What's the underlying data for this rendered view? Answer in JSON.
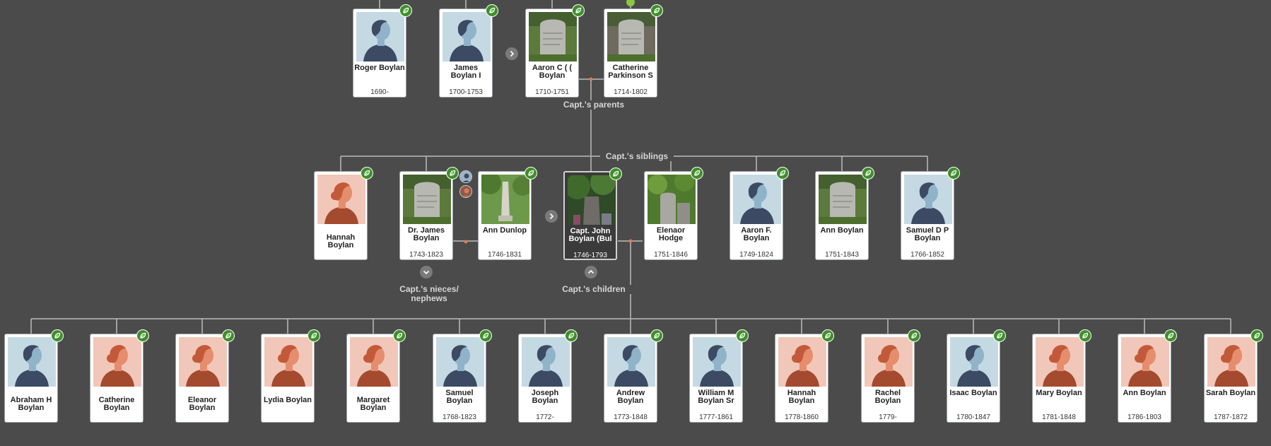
{
  "labels": {
    "parents": "Capt.'s parents",
    "siblings": "Capt.'s siblings",
    "nieces": "Capt.'s nieces/ nephews",
    "children": "Capt.'s children"
  },
  "icons": {
    "hint": "leaf-hint-icon",
    "expand_right": "chevron-right-icon",
    "expand_down": "chevron-down-icon",
    "collapse_up": "chevron-up-icon"
  },
  "colors": {
    "background": "#4b4b4b",
    "line": "#bdbdbd",
    "hint": "#3f8f2a",
    "male_bg": "#c5d9e3",
    "female_bg": "#f1c7b9"
  },
  "people": {
    "parents": [
      {
        "name": "Roger Boylan",
        "years": "1690-",
        "photo": "male"
      },
      {
        "name": "James Boylan I",
        "years": "1700-1753",
        "photo": "male"
      },
      {
        "name": "Aaron C ( ( Boylan",
        "years": "1710-1751",
        "photo": "grave"
      },
      {
        "name": "Catherine Parkinson S",
        "years": "1714-1802",
        "photo": "grave2"
      }
    ],
    "siblings": [
      {
        "name": "Hannah Boylan",
        "years": "",
        "photo": "female"
      },
      {
        "name": "Dr. James Boylan",
        "years": "1743-1823",
        "photo": "grave"
      },
      {
        "name": "Ann Dunlop",
        "years": "1746-1831",
        "photo": "monument"
      },
      {
        "name": "Capt. John Boylan (Bul",
        "years": "1746-1793",
        "photo": "tree"
      },
      {
        "name": "Elenaor Hodge",
        "years": "1751-1846",
        "photo": "grave3"
      },
      {
        "name": "Aaron F. Boylan",
        "years": "1749-1824",
        "photo": "male"
      },
      {
        "name": "Ann Boylan",
        "years": "1751-1843",
        "photo": "grave"
      },
      {
        "name": "Samuel D P Boylan",
        "years": "1766-1852",
        "photo": "male"
      }
    ],
    "children": [
      {
        "name": "Abraham H Boylan",
        "years": "",
        "photo": "male"
      },
      {
        "name": "Catherine Boylan",
        "years": "",
        "photo": "female"
      },
      {
        "name": "Eleanor Boylan",
        "years": "",
        "photo": "female"
      },
      {
        "name": "Lydia Boylan",
        "years": "",
        "photo": "female"
      },
      {
        "name": "Margaret Boylan",
        "years": "",
        "photo": "female"
      },
      {
        "name": "Samuel Boylan",
        "years": "1768-1823",
        "photo": "male"
      },
      {
        "name": "Joseph Boylan",
        "years": "1772-",
        "photo": "male"
      },
      {
        "name": "Andrew Boylan",
        "years": "1773-1848",
        "photo": "male"
      },
      {
        "name": "William M Boylan Sr",
        "years": "1777-1861",
        "photo": "male"
      },
      {
        "name": "Hannah Boylan",
        "years": "1778-1860",
        "photo": "female"
      },
      {
        "name": "Rachel Boylan",
        "years": "1779-",
        "photo": "female"
      },
      {
        "name": "Isaac Boylan",
        "years": "1780-1847",
        "photo": "male"
      },
      {
        "name": "Mary Boylan",
        "years": "1781-1848",
        "photo": "female"
      },
      {
        "name": "Ann Boylan",
        "years": "1786-1803",
        "photo": "female"
      },
      {
        "name": "Sarah Boylan",
        "years": "1787-1872",
        "photo": "female"
      }
    ]
  }
}
